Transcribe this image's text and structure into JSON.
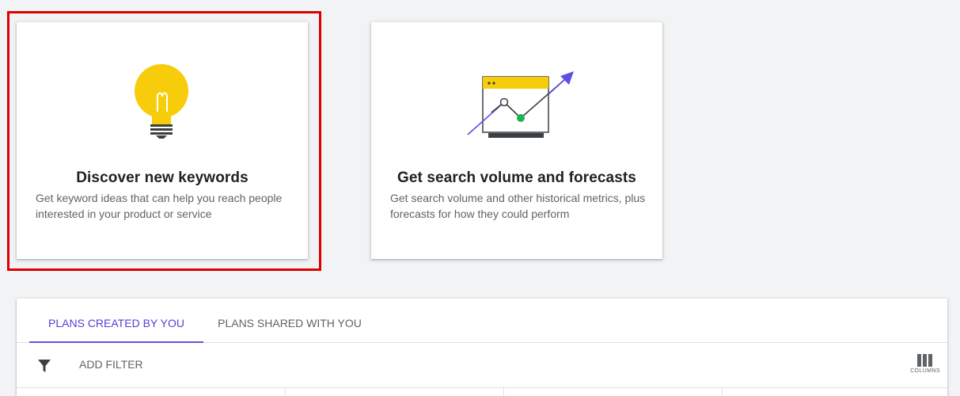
{
  "cards": [
    {
      "title": "Discover new keywords",
      "description": "Get keyword ideas that can help you reach people interested in your product or service",
      "icon": "lightbulb-icon"
    },
    {
      "title": "Get search volume and forecasts",
      "description": "Get search volume and other historical metrics, plus forecasts for how they could perform",
      "icon": "forecast-chart-icon"
    }
  ],
  "plans": {
    "tabs": [
      {
        "label": "PLANS CREATED BY YOU",
        "active": true
      },
      {
        "label": "PLANS SHARED WITH YOU",
        "active": false
      }
    ],
    "filter": {
      "icon": "filter-icon",
      "label": "ADD FILTER"
    },
    "columns": {
      "icon": "columns-icon",
      "label": "COLUMNS"
    }
  },
  "colors": {
    "accent": "#5041d8",
    "highlight": "#e00000",
    "bulb": "#f7cc0a",
    "arrow": "#5f4ee6",
    "point": "#1db254"
  }
}
